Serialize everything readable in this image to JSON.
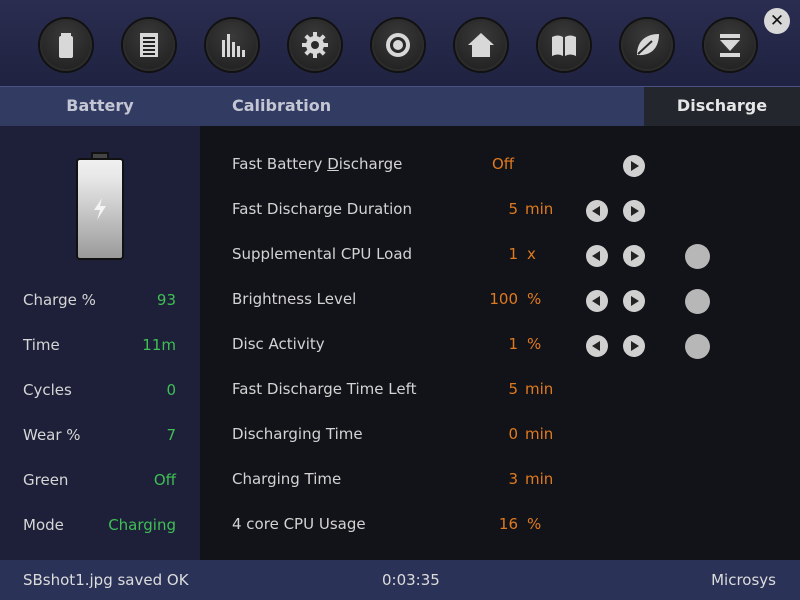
{
  "toolbar": {
    "icons": [
      "battery-icon",
      "list-icon",
      "bar-chart-icon",
      "gear-icon",
      "target-icon",
      "home-icon",
      "book-icon",
      "leaf-icon",
      "download-icon"
    ],
    "close_label": "✕"
  },
  "tabs": [
    {
      "label": "Battery",
      "active": false
    },
    {
      "label": "Calibration",
      "active": false
    },
    {
      "label": "Discharge",
      "active": true
    }
  ],
  "stats": [
    {
      "label": "Charge %",
      "value": "93"
    },
    {
      "label": "Time",
      "value": "11m"
    },
    {
      "label": "Cycles",
      "value": "0"
    },
    {
      "label": "Wear %",
      "value": "7"
    },
    {
      "label": "Green",
      "value": "Off"
    },
    {
      "label": "Mode",
      "value": "Charging"
    }
  ],
  "discharge_rows": [
    {
      "label_pre": "Fast Battery ",
      "label_mnemonic": "D",
      "label_post": "ischarge",
      "value": "Off",
      "unit": "",
      "prev": false,
      "next": true,
      "dot": false
    },
    {
      "label_pre": "Fast Discharge Duration",
      "label_mnemonic": "",
      "label_post": "",
      "value": "5",
      "unit": "min",
      "prev": true,
      "next": true,
      "dot": false
    },
    {
      "label_pre": "Supplemental CPU Load",
      "label_mnemonic": "",
      "label_post": "",
      "value": "1",
      "unit": "x",
      "prev": true,
      "next": true,
      "dot": true
    },
    {
      "label_pre": "Brightness Level",
      "label_mnemonic": "",
      "label_post": "",
      "value": "100",
      "unit": "%",
      "prev": true,
      "next": true,
      "dot": true
    },
    {
      "label_pre": "Disc Activity",
      "label_mnemonic": "",
      "label_post": "",
      "value": "1",
      "unit": "%",
      "prev": true,
      "next": true,
      "dot": true
    },
    {
      "label_pre": "Fast Discharge Time Left",
      "label_mnemonic": "",
      "label_post": "",
      "value": "5",
      "unit": "min",
      "prev": false,
      "next": false,
      "dot": false
    },
    {
      "label_pre": "Discharging Time",
      "label_mnemonic": "",
      "label_post": "",
      "value": "0",
      "unit": "min",
      "prev": false,
      "next": false,
      "dot": false
    },
    {
      "label_pre": "Charging Time",
      "label_mnemonic": "",
      "label_post": "",
      "value": "3",
      "unit": "min",
      "prev": false,
      "next": false,
      "dot": false
    },
    {
      "label_pre": "4 core CPU Usage",
      "label_mnemonic": "",
      "label_post": "",
      "value": "16",
      "unit": "%",
      "prev": false,
      "next": false,
      "dot": false
    }
  ],
  "status": {
    "message": "SBshot1.jpg saved OK",
    "clock": "0:03:35",
    "vendor": "Microsys"
  },
  "colors": {
    "value_green": "#3fbf55",
    "value_orange": "#e07a1f",
    "tab_bar": "#323b62",
    "status_bar": "#2b3257"
  }
}
